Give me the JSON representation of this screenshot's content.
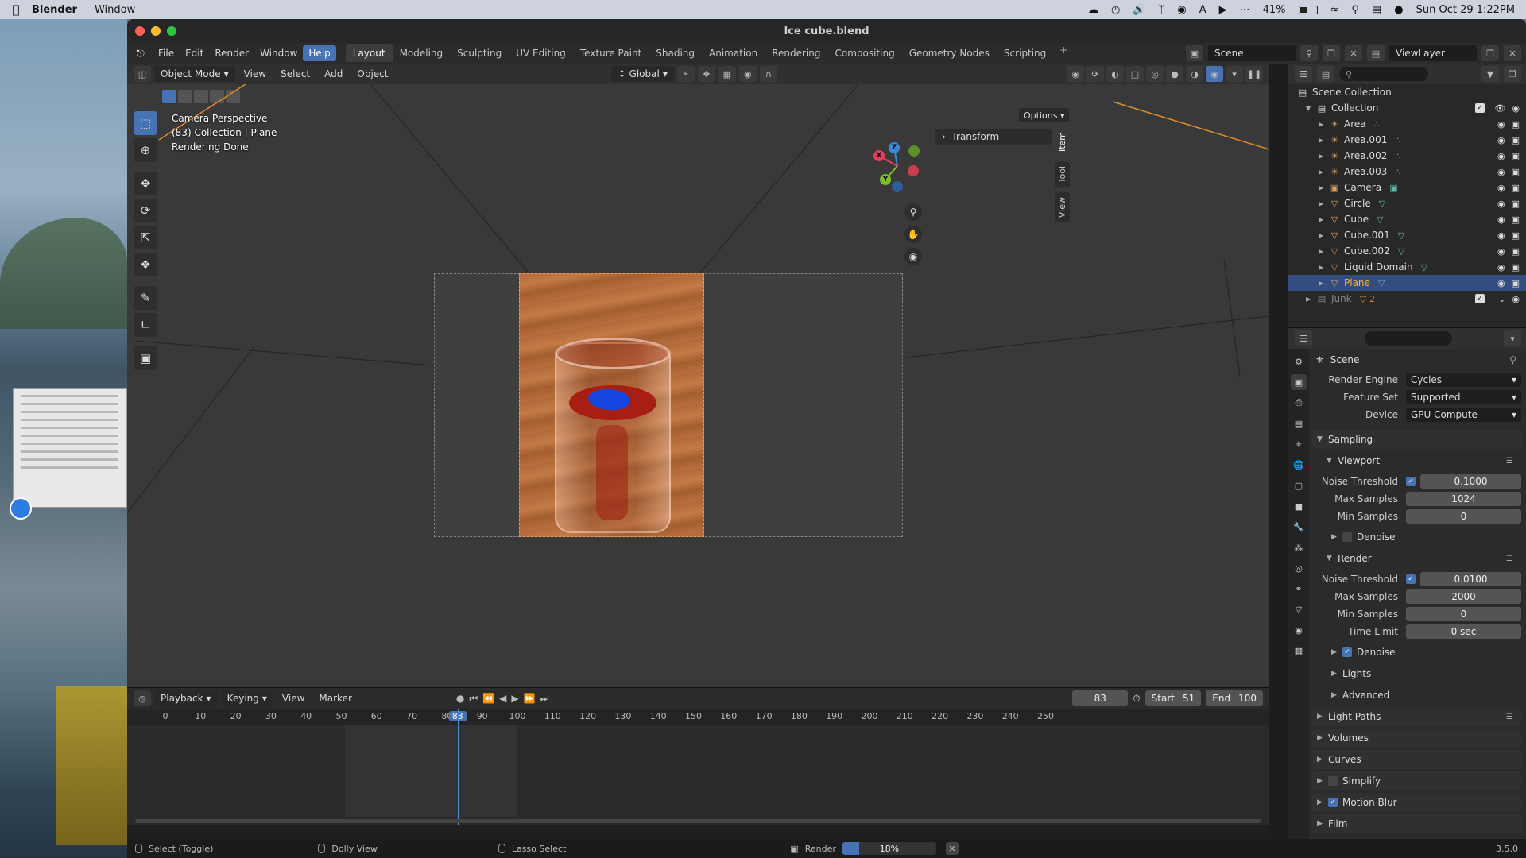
{
  "mac_menubar": {
    "app": "Blender",
    "menus": [
      "Window"
    ],
    "battery": "41%",
    "datetime": "Sun Oct 29  1:22PM"
  },
  "window": {
    "title": "Ice cube.blend"
  },
  "topbar": {
    "menus": [
      "File",
      "Edit",
      "Render",
      "Window",
      "Help"
    ],
    "active_menu": "Help",
    "workspaces": [
      "Layout",
      "Modeling",
      "Sculpting",
      "UV Editing",
      "Texture Paint",
      "Shading",
      "Animation",
      "Rendering",
      "Compositing",
      "Geometry Nodes",
      "Scripting"
    ],
    "active_workspace": "Layout",
    "scene": "Scene",
    "view_layer": "ViewLayer"
  },
  "viewport_header": {
    "mode": "Object Mode",
    "menus": [
      "View",
      "Select",
      "Add",
      "Object"
    ],
    "orientation": "Global",
    "options": "Options"
  },
  "viewport": {
    "info": [
      "Camera Perspective",
      "(83) Collection | Plane",
      "Rendering Done"
    ],
    "sidebar_panel": "Transform",
    "sidebar_tabs": [
      "Item",
      "Tool",
      "View"
    ],
    "gizmo_axes": [
      "X",
      "Y",
      "Z"
    ]
  },
  "outliner": {
    "root": "Scene Collection",
    "collection": "Collection",
    "items": [
      {
        "name": "Area",
        "type": "light",
        "selected": false
      },
      {
        "name": "Area.001",
        "type": "light",
        "selected": false
      },
      {
        "name": "Area.002",
        "type": "light",
        "selected": false
      },
      {
        "name": "Area.003",
        "type": "light",
        "selected": false
      },
      {
        "name": "Camera",
        "type": "camera",
        "selected": false
      },
      {
        "name": "Circle",
        "type": "mesh",
        "selected": false
      },
      {
        "name": "Cube",
        "type": "mesh",
        "selected": false
      },
      {
        "name": "Cube.001",
        "type": "mesh",
        "selected": false
      },
      {
        "name": "Cube.002",
        "type": "mesh",
        "selected": false
      },
      {
        "name": "Liquid Domain",
        "type": "mesh",
        "selected": false
      },
      {
        "name": "Plane",
        "type": "mesh",
        "selected": true
      }
    ],
    "junk": "Junk",
    "junk_count": "2"
  },
  "properties": {
    "context": "Scene",
    "render_engine_label": "Render Engine",
    "render_engine": "Cycles",
    "feature_set_label": "Feature Set",
    "feature_set": "Supported",
    "device_label": "Device",
    "device": "GPU Compute",
    "sampling": "Sampling",
    "viewport": {
      "title": "Viewport",
      "noise_threshold_label": "Noise Threshold",
      "noise_threshold": "0.1000",
      "max_samples_label": "Max Samples",
      "max_samples": "1024",
      "min_samples_label": "Min Samples",
      "min_samples": "0",
      "denoise": "Denoise"
    },
    "render": {
      "title": "Render",
      "noise_threshold_label": "Noise Threshold",
      "noise_threshold": "0.0100",
      "max_samples_label": "Max Samples",
      "max_samples": "2000",
      "min_samples_label": "Min Samples",
      "min_samples": "0",
      "time_limit_label": "Time Limit",
      "time_limit": "0 sec",
      "denoise": "Denoise",
      "lights": "Lights",
      "advanced": "Advanced"
    },
    "sections": [
      "Light Paths",
      "Volumes",
      "Curves",
      "Simplify",
      "Motion Blur",
      "Film"
    ]
  },
  "timeline": {
    "menus": [
      "Playback",
      "Keying",
      "View",
      "Marker"
    ],
    "current_frame": "83",
    "start_label": "Start",
    "start": "51",
    "end_label": "End",
    "end": "100",
    "ruler_ticks": [
      "0",
      "10",
      "20",
      "30",
      "40",
      "50",
      "60",
      "70",
      "80",
      "90",
      "100",
      "110",
      "120",
      "130",
      "140",
      "150",
      "160",
      "170",
      "180",
      "190",
      "200",
      "210",
      "220",
      "230",
      "240",
      "250"
    ]
  },
  "statusbar": {
    "select": "Select (Toggle)",
    "dolly": "Dolly View",
    "lasso": "Lasso Select",
    "render_label": "Render",
    "render_progress": "18%",
    "render_progress_fraction": 0.18,
    "version": "3.5.0"
  }
}
